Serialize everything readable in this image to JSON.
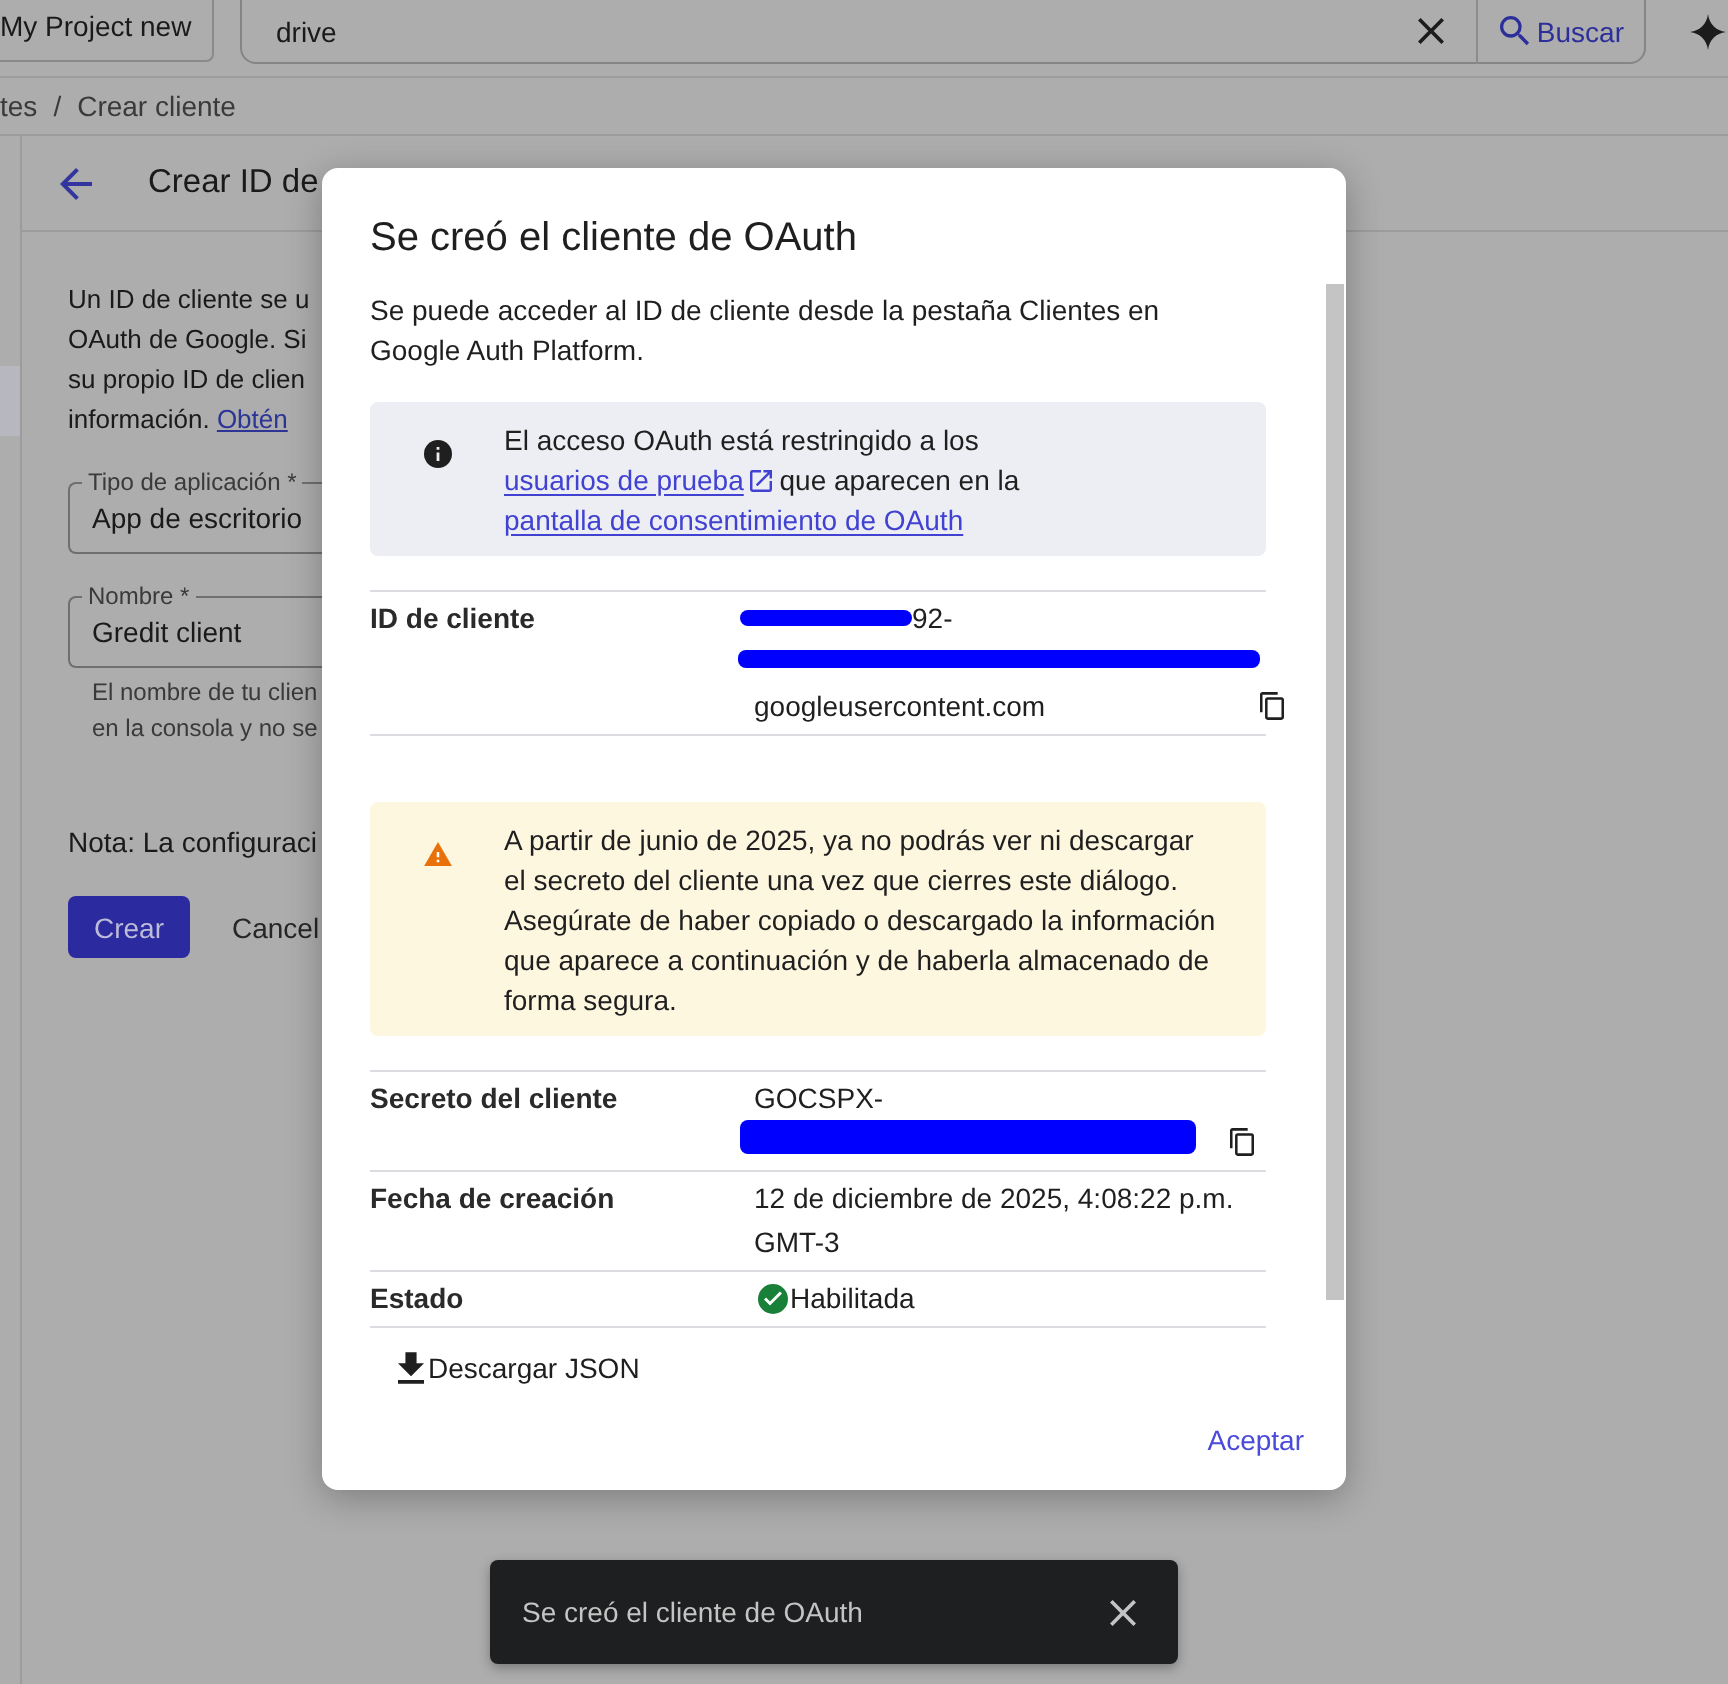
{
  "top_bar": {
    "project_button": "My Project new",
    "search": {
      "value": "drive"
    },
    "search_button": "Buscar"
  },
  "breadcrumb": {
    "items": [
      "tes",
      "Crear cliente"
    ],
    "separator": "/"
  },
  "sidebar": {
    "items": [
      {
        "selected": true
      }
    ]
  },
  "page": {
    "title": "Crear ID de",
    "intro": {
      "lines": [
        "Un ID de cliente se u",
        "OAuth de Google. Si",
        "su propio ID de clien",
        "información."
      ],
      "link": "Obtén"
    },
    "fields": [
      {
        "label": "Tipo de aplicación *",
        "value": "App de escritorio"
      },
      {
        "label": "Nombre *",
        "value": "Gredit client"
      }
    ],
    "helper_lines": [
      "El nombre de tu clien",
      "en la consola y no se"
    ],
    "note": "Nota: La configuraci",
    "buttons": [
      {
        "label": "Crear",
        "kind": "primary"
      },
      {
        "label": "Cancel",
        "kind": "text"
      }
    ]
  },
  "dialog": {
    "title": "Se creó el cliente de OAuth",
    "description": "Se puede acceder al ID de cliente desde la pestaña Clientes en Google Auth Platform.",
    "info_notice": {
      "parts": [
        {
          "kind": "text",
          "text": "El acceso OAuth está restringido a los "
        },
        {
          "kind": "external_link",
          "text": "usuarios de prueba"
        },
        {
          "kind": "text",
          "text": " que aparecen en la "
        },
        {
          "kind": "link",
          "text": "pantalla de consentimiento de OAuth"
        }
      ]
    },
    "items": [
      {
        "kind": "detail",
        "label": "ID de cliente",
        "lines": [
          {
            "kind": "scribbled_text",
            "text": "92-"
          },
          {
            "kind": "scribble"
          },
          {
            "kind": "text",
            "text": "googleusercontent.com"
          }
        ],
        "copyable": true
      },
      {
        "kind": "warning",
        "text": "A partir de junio de 2025, ya no podrás ver ni descargar el secreto del cliente una vez que cierres este diálogo. Asegúrate de haber copiado o descargado la información que aparece a continuación y de haberla almacenado de forma segura."
      },
      {
        "kind": "detail",
        "label": "Secreto del cliente",
        "lines": [
          {
            "kind": "text",
            "text": "GOCSPX-"
          },
          {
            "kind": "block"
          }
        ],
        "copyable": true
      },
      {
        "kind": "detail",
        "label": "Fecha de creación",
        "lines": [
          {
            "kind": "text",
            "text": "12 de diciembre de 2025, 4:08:22 p.m. GMT-3"
          }
        ]
      },
      {
        "kind": "detail",
        "label": "Estado",
        "lines": [
          {
            "kind": "status",
            "text": "Habilitada"
          }
        ]
      }
    ],
    "download_button": "Descargar JSON",
    "accept_button": "Aceptar"
  },
  "snackbar": {
    "message": "Se creó el cliente de OAuth"
  }
}
